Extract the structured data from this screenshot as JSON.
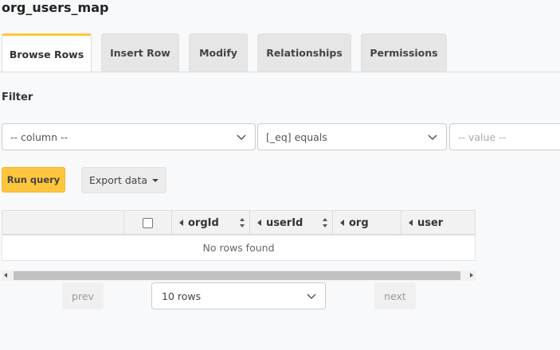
{
  "page": {
    "title": "org_users_map"
  },
  "tabs": [
    {
      "label": "Browse Rows",
      "active": true
    },
    {
      "label": "Insert Row",
      "active": false
    },
    {
      "label": "Modify",
      "active": false
    },
    {
      "label": "Relationships",
      "active": false
    },
    {
      "label": "Permissions",
      "active": false
    }
  ],
  "filter": {
    "label": "Filter",
    "column_select": "-- column --",
    "operator_select": "[_eq] equals",
    "value_placeholder": "-- value --"
  },
  "actions": {
    "run_query": "Run query",
    "export_data": "Export data"
  },
  "grid": {
    "columns": [
      "orgId",
      "userId",
      "org",
      "user"
    ],
    "empty_message": "No rows found"
  },
  "pagination": {
    "prev": "prev",
    "next": "next",
    "page_size": "10 rows"
  },
  "colors": {
    "accent": "#fec53d",
    "background": "#f8f9fb"
  },
  "icons": {
    "select_chevron": "chevron-down-icon",
    "column_expand": "caret-left-icon",
    "sort": "sort-icon"
  }
}
